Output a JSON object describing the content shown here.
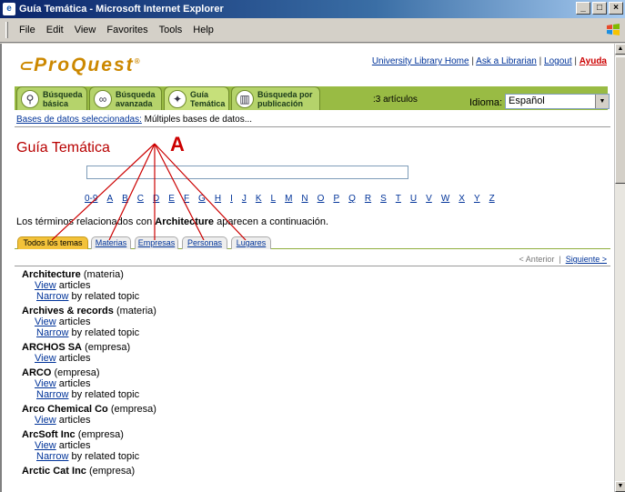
{
  "window": {
    "title": "Guía Temática - Microsoft Internet Explorer",
    "controls": [
      "_",
      "□",
      "×"
    ]
  },
  "menubar": {
    "items": [
      "File",
      "Edit",
      "View",
      "Favorites",
      "Tools",
      "Help"
    ]
  },
  "header": {
    "logo": "ProQuest",
    "toplinks": {
      "home": "University Library Home",
      "sep1": "|",
      "librarian": "Ask a Librarian",
      "sep2": "|",
      "logout": "Logout",
      "sep3": "|",
      "help": "Ayuda"
    },
    "tabs": [
      {
        "label": "Búsqueda básica",
        "icon": "magnifier-icon"
      },
      {
        "label": "Búsqueda avanzada",
        "icon": "binoculars-icon"
      },
      {
        "label": "Guía Temática",
        "icon": "compass-icon"
      },
      {
        "label": "Búsqueda por publicación",
        "icon": "book-icon"
      }
    ],
    "articles": ":3 artículos",
    "idioma_label": "Idioma:",
    "idioma_value": "Español"
  },
  "db": {
    "link": "Bases de datos seleccionadas:",
    "value": "Múltiples bases de datos..."
  },
  "guia": {
    "title": "Guía Temática",
    "search_value": "",
    "alphabet": [
      "0-9",
      "A",
      "B",
      "C",
      "D",
      "E",
      "F",
      "G",
      "H",
      "I",
      "J",
      "K",
      "L",
      "M",
      "N",
      "O",
      "P",
      "Q",
      "R",
      "S",
      "T",
      "U",
      "V",
      "W",
      "X",
      "Y",
      "Z"
    ],
    "related_prefix": "Los términos relacionados con ",
    "related_term": "Architecture",
    "related_suffix": " aparecen a continuación.",
    "subtabs": [
      "Todos los temas",
      "Materias",
      "Empresas",
      "Personas",
      "Lugares"
    ],
    "pager_prev": "< Anterior",
    "pager_sep": "|",
    "pager_next": "Siguiente >"
  },
  "annotation": {
    "label": "A",
    "color": "#cc0000"
  },
  "results": [
    {
      "name": "Architecture",
      "type": "(materia)",
      "view": "View",
      "view_suffix": " articles",
      "narrow": "Narrow",
      "narrow_suffix": " by related topic"
    },
    {
      "name": "Archives & records",
      "type": "(materia)",
      "view": "View",
      "view_suffix": " articles",
      "narrow": "Narrow",
      "narrow_suffix": " by related topic"
    },
    {
      "name": "ARCHOS SA",
      "type": "(empresa)",
      "view": "View",
      "view_suffix": " articles"
    },
    {
      "name": "ARCO",
      "type": "(empresa)",
      "view": "View",
      "view_suffix": " articles",
      "narrow": "Narrow",
      "narrow_suffix": " by related topic"
    },
    {
      "name": "Arco Chemical Co",
      "type": "(empresa)",
      "view": "View",
      "view_suffix": " articles"
    },
    {
      "name": "ArcSoft Inc",
      "type": "(empresa)",
      "view": "View",
      "view_suffix": " articles",
      "narrow": "Narrow",
      "narrow_suffix": " by related topic"
    },
    {
      "name": "Arctic Cat Inc",
      "type": "(empresa)"
    }
  ]
}
